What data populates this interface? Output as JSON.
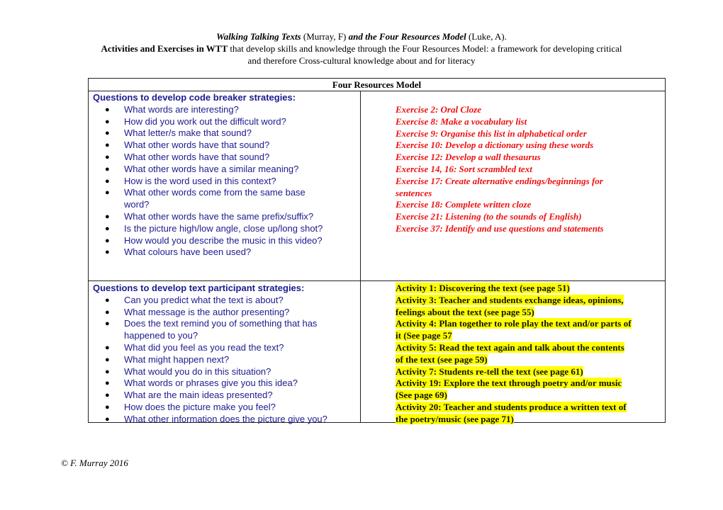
{
  "header": {
    "line1": {
      "title_a": "Walking Talking Texts",
      "author_a": " (Murray, F) ",
      "title_b": "and the Four Resources Model",
      "author_b": " (Luke, A)."
    },
    "line2": {
      "bold": "Activities and Exercises in WTT",
      "rest": " that develop skills and knowledge through the Four Resources Model: a framework for developing critical"
    },
    "line3": "and therefore Cross-cultural knowledge about and for literacy"
  },
  "table": {
    "heading": "Four Resources Model",
    "code_breaker": {
      "heading": "Questions to develop code breaker strategies:",
      "questions": [
        "What words are interesting?",
        "How did you work out the difficult word?",
        "What letter/s make that sound?",
        "What other words have that sound?",
        "What other words have that sound?",
        "What other words have a similar meaning?",
        "How is the word used in this context?",
        "What other words come from the same base word?",
        "What other words have the same prefix/suffix?",
        "Is the picture high/low angle, close up/long shot?",
        "How would you describe the music in this video?",
        "What colours have been used?"
      ],
      "exercises": [
        "Exercise 2: Oral Cloze",
        "Exercise 8: Make a vocabulary list",
        "Exercise 9: Organise this list in alphabetical order",
        "Exercise 10: Develop a dictionary using these words",
        "Exercise 12: Develop a wall thesaurus",
        "Exercise 14, 16: Sort scrambled text",
        "Exercise 17: Create alternative endings/beginnings for sentences",
        "Exercise 18: Complete written cloze",
        "Exercise 21: Listening (to the sounds of English)",
        "Exercise 37: Identify and use questions and statements"
      ]
    },
    "text_participant": {
      "heading": "Questions to develop text participant strategies:",
      "questions": [
        "Can you predict what the text is about?",
        "What message is the author presenting?",
        "Does the text remind you of something that has happened to you?",
        "What did you feel as you read the text?",
        "What might happen next?",
        "What would you do in this situation?",
        "What words or phrases give you this idea?",
        "What are the main ideas presented?",
        "How does the picture make you feel?",
        "What other information does the picture give you?"
      ],
      "activity_lines": [
        "Activity 1: Discovering the text (see page 51)",
        "Activity 3: Teacher and students exchange ideas, opinions,",
        "feelings about the text (see page 55)",
        "Activity 4: Plan together to role play the text and/or parts of",
        "it (See page 57",
        "Activity 5: Read the text again and talk about the contents",
        "of the text (see page 59)",
        "Activity 7: Students re-tell the text (see page 61)",
        "Activity 19: Explore the text through poetry and/or music",
        "(See page 69)",
        "Activity 20: Teacher and students produce a written text of",
        "the poetry/music (see page 71)"
      ]
    }
  },
  "footer": "© F. Murray 2016",
  "colors": {
    "question_text": "#1b1b8f",
    "exercise_text": "#ee1111",
    "highlight": "#ffff00"
  }
}
